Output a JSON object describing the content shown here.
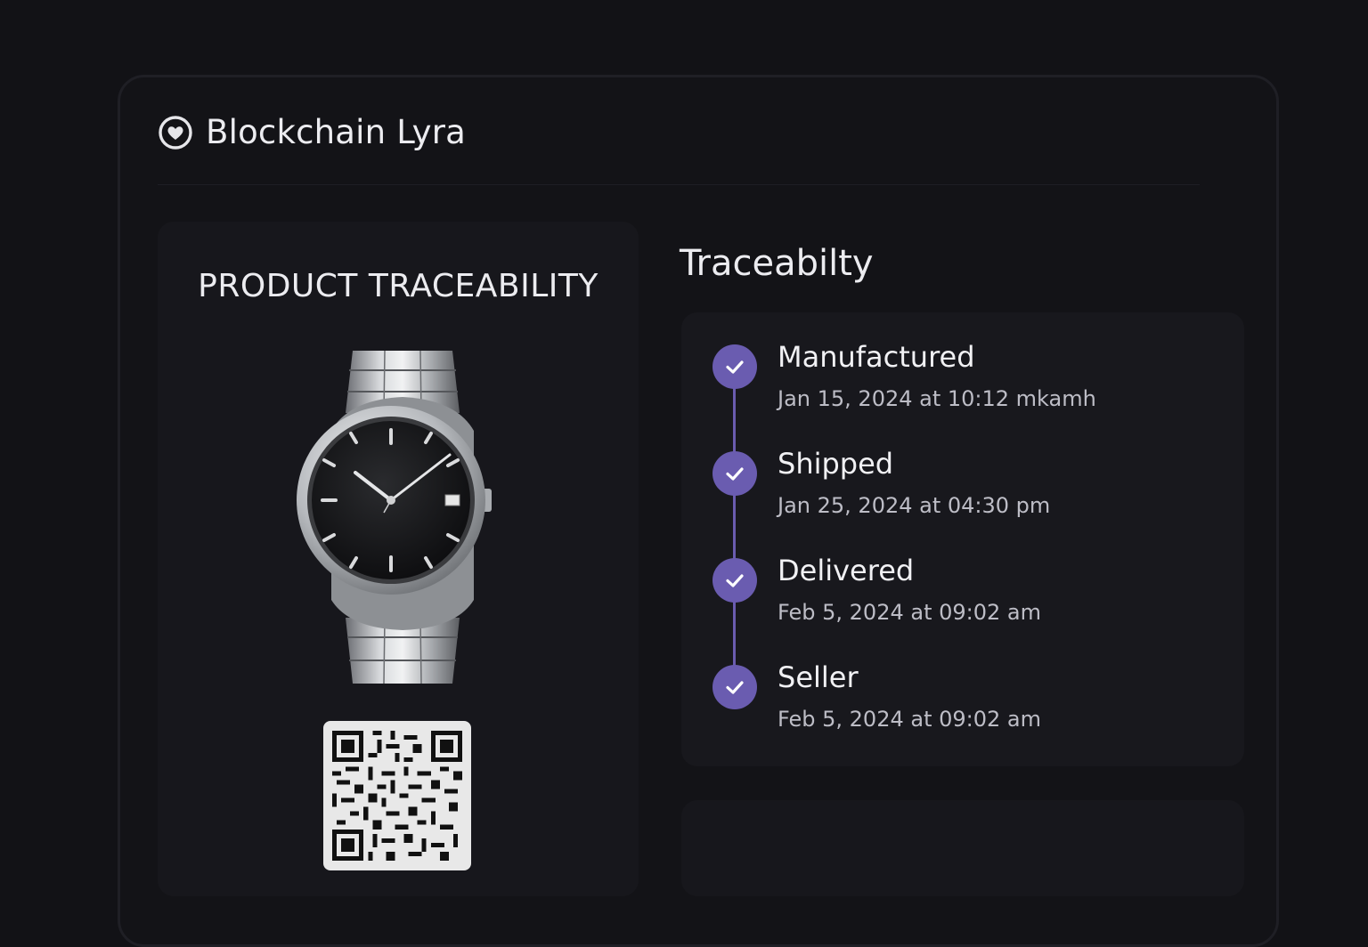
{
  "app": {
    "title": "Blockchain Lyra",
    "logo_icon": "heart-circle-icon"
  },
  "product": {
    "heading": "PRODUCT TRACEABILITY",
    "image_icon": "wristwatch-image",
    "qr_icon": "qr-code-icon"
  },
  "traceability": {
    "heading": "Traceabilty",
    "steps": [
      {
        "label": "Manufactured",
        "time": "Jan 15, 2024 at 10:12 mkamh",
        "status_icon": "check-icon"
      },
      {
        "label": "Shipped",
        "time": "Jan 25, 2024 at 04:30 pm",
        "status_icon": "check-icon"
      },
      {
        "label": "Delivered",
        "time": "Feb 5, 2024 at 09:02 am",
        "status_icon": "check-icon"
      },
      {
        "label": "Seller",
        "time": "Feb 5, 2024 at 09:02 am",
        "status_icon": "check-icon"
      }
    ]
  },
  "colors": {
    "accent": "#6a5cb0",
    "background": "#121216",
    "card": "#17171c"
  }
}
